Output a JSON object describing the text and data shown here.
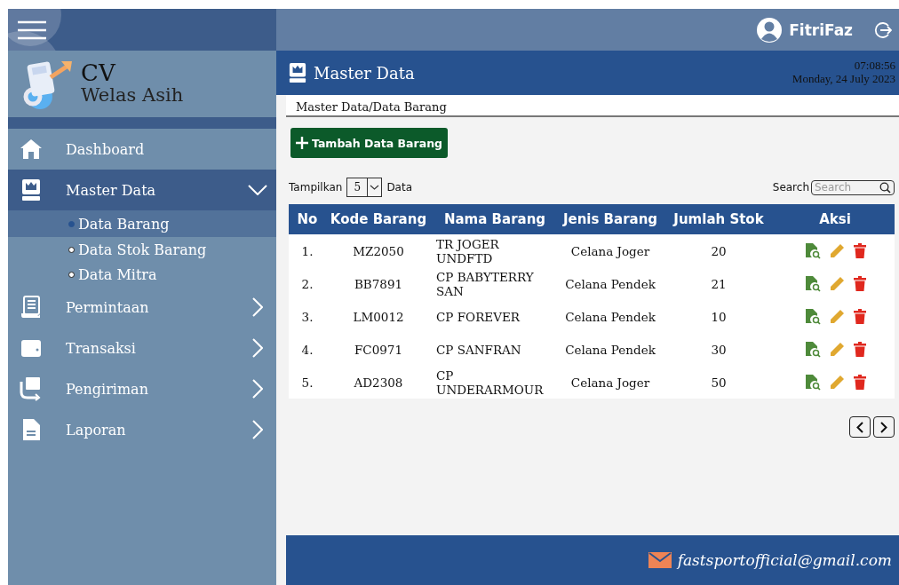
{
  "user": {
    "name": "FitriFaz"
  },
  "brand": {
    "line_1": "CV",
    "line_2": "Welas Asih"
  },
  "sidebar": {
    "items": [
      {
        "label": "Dashboard",
        "selected": false
      },
      {
        "label": "Master Data",
        "selected": true,
        "expanded": true,
        "children": [
          {
            "label": "Data Barang",
            "selected": true
          },
          {
            "label": "Data Stok Barang",
            "selected": false
          },
          {
            "label": "Data Mitra",
            "selected": false
          }
        ]
      },
      {
        "label": "Permintaan",
        "selected": false,
        "expanded": false
      },
      {
        "label": "Transaksi",
        "selected": false,
        "expanded": false
      },
      {
        "label": "Pengiriman",
        "selected": false,
        "expanded": false
      },
      {
        "label": "Laporan",
        "selected": false,
        "expanded": false
      }
    ]
  },
  "page": {
    "title": "Master Data",
    "time": "07:08:56",
    "date": "Monday, 24 July 2023",
    "breadcrumb": "Master Data/Data Barang"
  },
  "toolbar": {
    "add_button": "Tambah Data Barang",
    "show_label": "Tampilkan",
    "page_size": "5",
    "show_suffix": "Data",
    "search_label": "Search",
    "search_placeholder": "Search"
  },
  "table": {
    "columns": [
      "No",
      "Kode Barang",
      "Nama  Barang",
      "Jenis Barang",
      "Jumlah Stok",
      "Aksi"
    ],
    "rows": [
      [
        "1.",
        "MZ2050",
        "TR JOGER UNDFTD",
        "Celana Joger",
        "20"
      ],
      [
        "2.",
        "BB7891",
        "CP BABYTERRY SAN",
        "Celana Pendek",
        "21"
      ],
      [
        "3.",
        "LM0012",
        "CP FOREVER",
        "Celana Pendek",
        "10"
      ],
      [
        "4.",
        "FC0971",
        "CP SANFRAN",
        "Celana Pendek",
        "30"
      ],
      [
        "5.",
        "AD2308",
        "CP UNDERARMOUR",
        "Celana Joger",
        "50"
      ]
    ]
  },
  "footer": {
    "email": "fastsportofficial@gmail.com"
  }
}
